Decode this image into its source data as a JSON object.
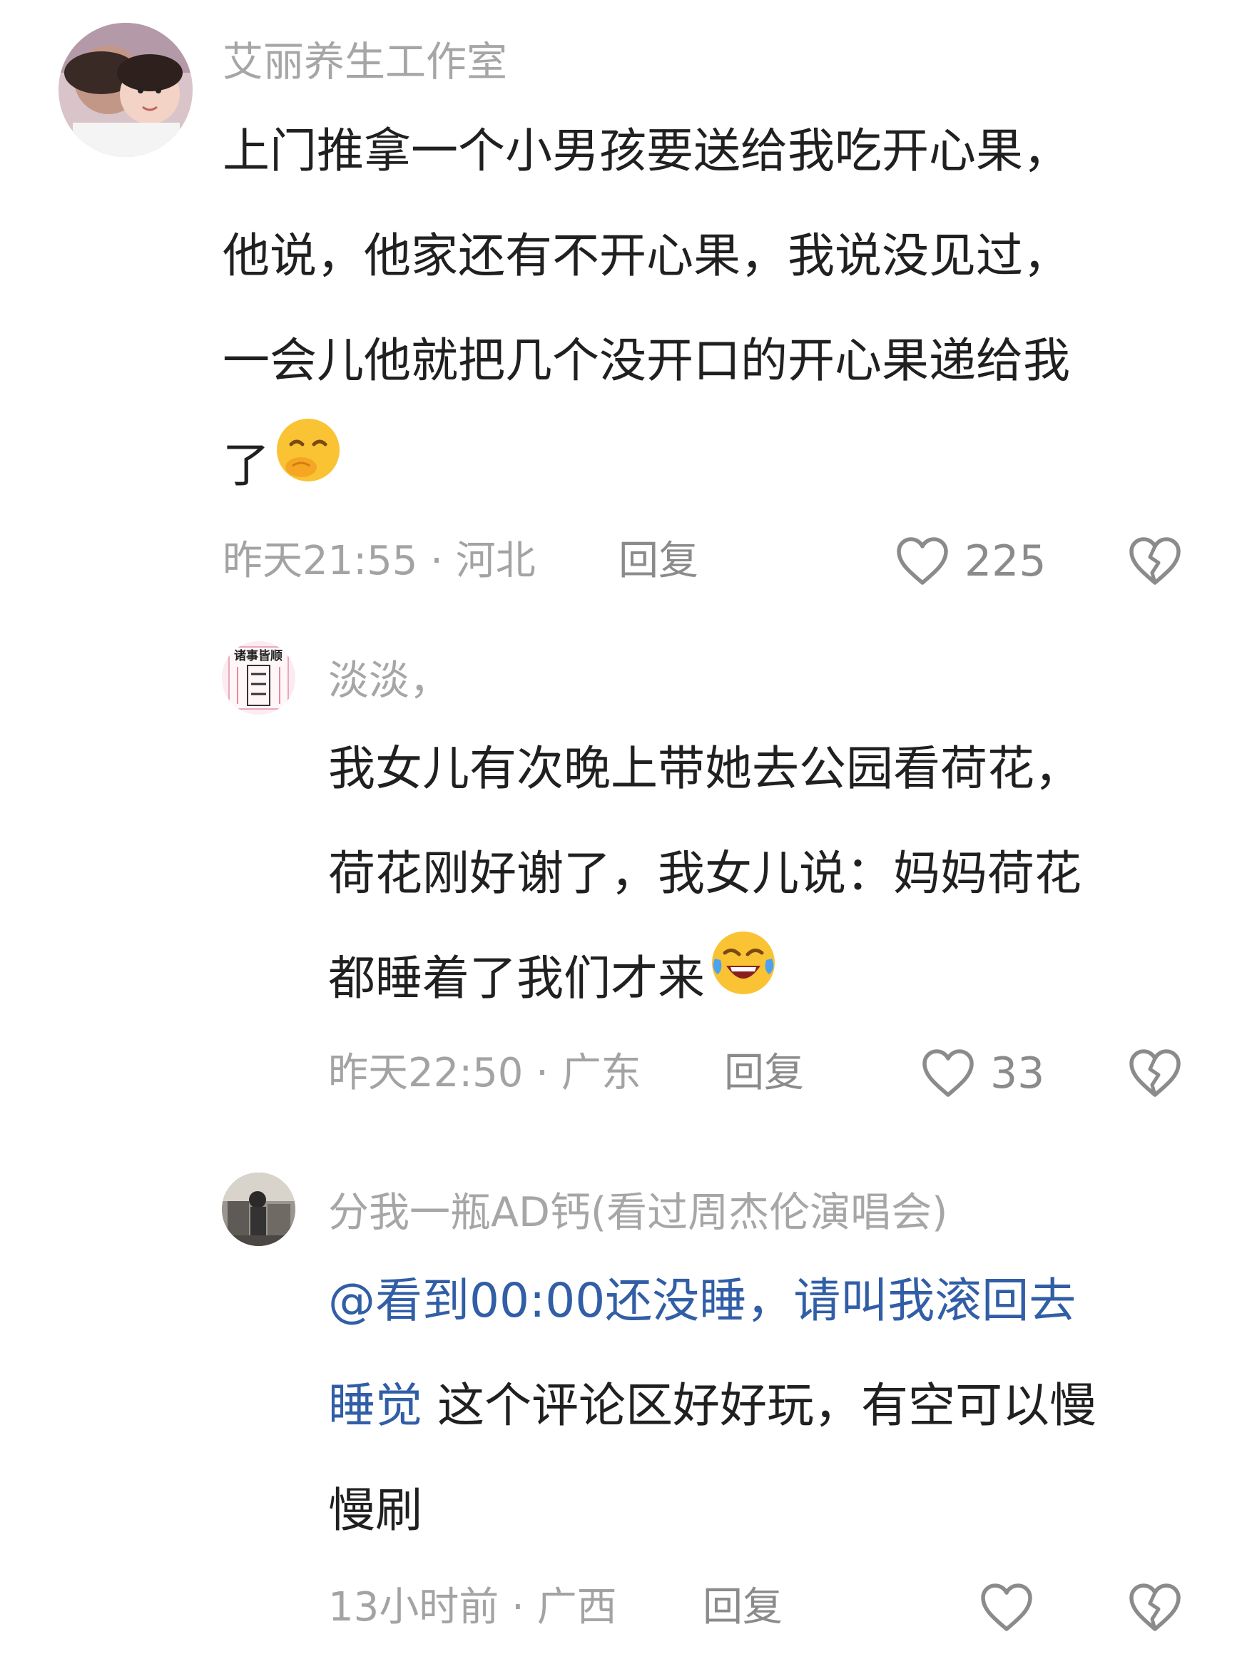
{
  "comments": [
    {
      "username": "艾丽养生工作室",
      "lines": [
        "上门推拿一个小男孩要送给我吃开心果，",
        "他说，他家还有不开心果，我说没见过，",
        "一会儿他就把几个没开口的开心果递给我",
        "了"
      ],
      "emoji": "smirk-face-emoji",
      "time_location": "昨天21:55 · 河北",
      "reply_label": "回复",
      "likes": "225"
    },
    {
      "username": "淡淡，",
      "avatar_text": "诸事皆顺",
      "lines": [
        "我女儿有次晚上带她去公园看荷花，",
        "荷花刚好谢了，我女儿说：妈妈荷花",
        "都睡着了我们才来"
      ],
      "emoji": "laughing-crying-face-emoji",
      "time_location": "昨天22:50 · 广东",
      "reply_label": "回复",
      "likes": "33"
    },
    {
      "username": "分我一瓶AD钙(看过周杰伦演唱会)",
      "mention": "@看到00:00还没睡，请叫我滚回去",
      "mention_cont": "睡觉",
      "line2_text": " 这个评论区好好玩，有空可以慢",
      "line3_text": "慢刷",
      "time_location": "13小时前 · 广西",
      "reply_label": "回复",
      "likes": ""
    }
  ],
  "icons": {
    "like": "heart-outline-icon",
    "dislike": "broken-heart-icon"
  },
  "colors": {
    "mention": "#315ea6",
    "body_text": "#202020",
    "meta_text": "#a3a3a3",
    "icon": "#8b8b8b"
  }
}
